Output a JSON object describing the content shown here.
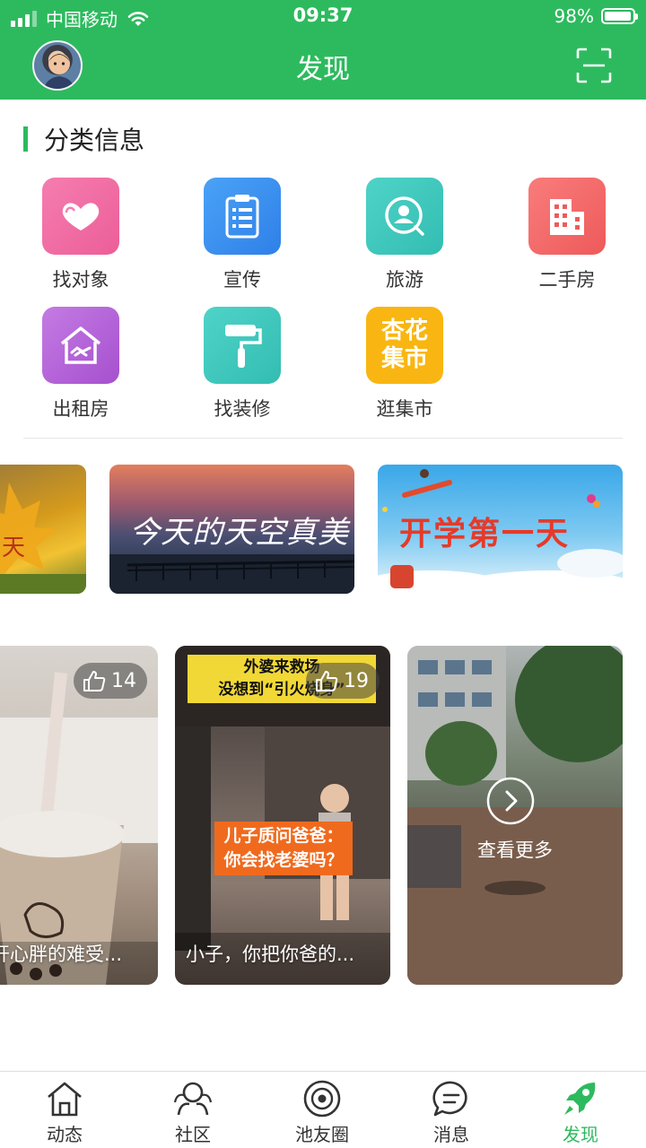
{
  "status_bar": {
    "carrier": "中国移动",
    "time": "09:37",
    "battery": "98%",
    "battery_level": 0.98
  },
  "header": {
    "title": "发现"
  },
  "section": {
    "title": "分类信息"
  },
  "categories": [
    {
      "label": "找对象",
      "icon": "hearts-icon",
      "color": "#ef6aa0"
    },
    {
      "label": "宣传",
      "icon": "clipboard-icon",
      "color": "#3b8ff0"
    },
    {
      "label": "旅游",
      "icon": "person-search-icon",
      "color": "#3cc6bc"
    },
    {
      "label": "二手房",
      "icon": "building-icon",
      "color": "#f46a6a"
    },
    {
      "label": "出租房",
      "icon": "house-handshake-icon",
      "color": "#b562d8"
    },
    {
      "label": "找装修",
      "icon": "paint-roller-icon",
      "color": "#3cc6bc"
    },
    {
      "label": "逛集市",
      "icon": "market-badge-icon",
      "color": "#f9b612",
      "badge": [
        "杏花",
        "集市"
      ]
    }
  ],
  "banners": [
    {
      "text": "天"
    },
    {
      "text": "今天的天空真美"
    },
    {
      "text": "开学第一天"
    }
  ],
  "videos": [
    {
      "likes": "14",
      "caption": "开心胖的难受..."
    },
    {
      "likes": "19",
      "caption": "小子，你把你爸的...",
      "overlay_top": [
        "外婆来救场",
        "没想到“引火烧身”"
      ],
      "overlay_mid": [
        "儿子质问爸爸：",
        "你会找老婆吗？"
      ]
    },
    {
      "more_label": "查看更多"
    }
  ],
  "tabs": [
    {
      "label": "动态",
      "icon": "home-icon"
    },
    {
      "label": "社区",
      "icon": "community-icon"
    },
    {
      "label": "池友圈",
      "icon": "circle-feed-icon"
    },
    {
      "label": "消息",
      "icon": "message-icon"
    },
    {
      "label": "发现",
      "icon": "rocket-icon",
      "active": true
    }
  ],
  "colors": {
    "brand": "#2dba5e"
  }
}
